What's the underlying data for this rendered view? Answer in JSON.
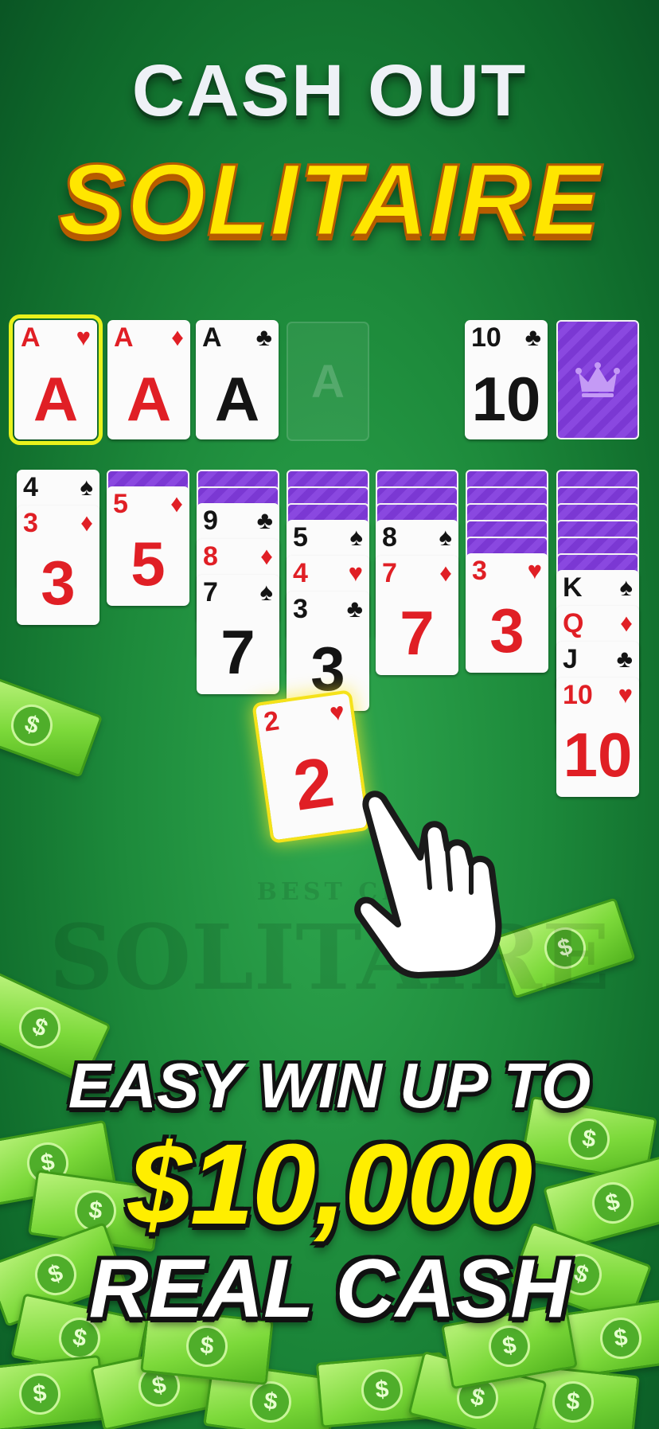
{
  "headline": {
    "line1": "CASH OUT",
    "line2": "SOLITAIRE"
  },
  "foundation": [
    {
      "rank": "A",
      "suit": "♥",
      "color": "red"
    },
    {
      "rank": "A",
      "suit": "♦",
      "color": "red"
    },
    {
      "rank": "A",
      "suit": "♣",
      "color": "black"
    },
    {
      "placeholder": "A"
    }
  ],
  "waste": {
    "rank": "10",
    "suit": "♣",
    "color": "black"
  },
  "stock": {
    "icon": "crown-icon"
  },
  "tableau": [
    {
      "hidden": 0,
      "cards": [
        {
          "rank": "4",
          "suit": "♠"
        },
        {
          "rank": "3",
          "suit": "♦"
        }
      ]
    },
    {
      "hidden": 1,
      "cards": [
        {
          "rank": "5",
          "suit": "♦"
        }
      ]
    },
    {
      "hidden": 2,
      "cards": [
        {
          "rank": "9",
          "suit": "♣"
        },
        {
          "rank": "8",
          "suit": "♦"
        },
        {
          "rank": "7",
          "suit": "♠"
        }
      ]
    },
    {
      "hidden": 3,
      "cards": [
        {
          "rank": "5",
          "suit": "♠"
        },
        {
          "rank": "4",
          "suit": "♥"
        },
        {
          "rank": "3",
          "suit": "♣"
        }
      ]
    },
    {
      "hidden": 3,
      "cards": [
        {
          "rank": "8",
          "suit": "♠"
        },
        {
          "rank": "7",
          "suit": "♦"
        }
      ]
    },
    {
      "hidden": 5,
      "cards": [
        {
          "rank": "3",
          "suit": "♥"
        }
      ]
    },
    {
      "hidden": 6,
      "cards": [
        {
          "rank": "K",
          "suit": "♠"
        },
        {
          "rank": "Q",
          "suit": "♦"
        },
        {
          "rank": "J",
          "suit": "♣"
        },
        {
          "rank": "10",
          "suit": "♥"
        }
      ]
    }
  ],
  "dragged_card": {
    "rank": "2",
    "suit": "♥",
    "color": "red"
  },
  "watermark": {
    "small": "BEST CL",
    "big": "SOLITAIRE"
  },
  "promo": {
    "line1": "EASY WIN UP TO",
    "line2": "$10,000",
    "line3": "REAL CASH"
  },
  "bill_symbol": "$",
  "colors": {
    "felt": "#1d8a3b",
    "red_suit": "#e01f25",
    "black_suit": "#141414",
    "card_back": "#7b38d3",
    "headline_yellow": "#ffe600",
    "highlight": "#e9f21c"
  }
}
